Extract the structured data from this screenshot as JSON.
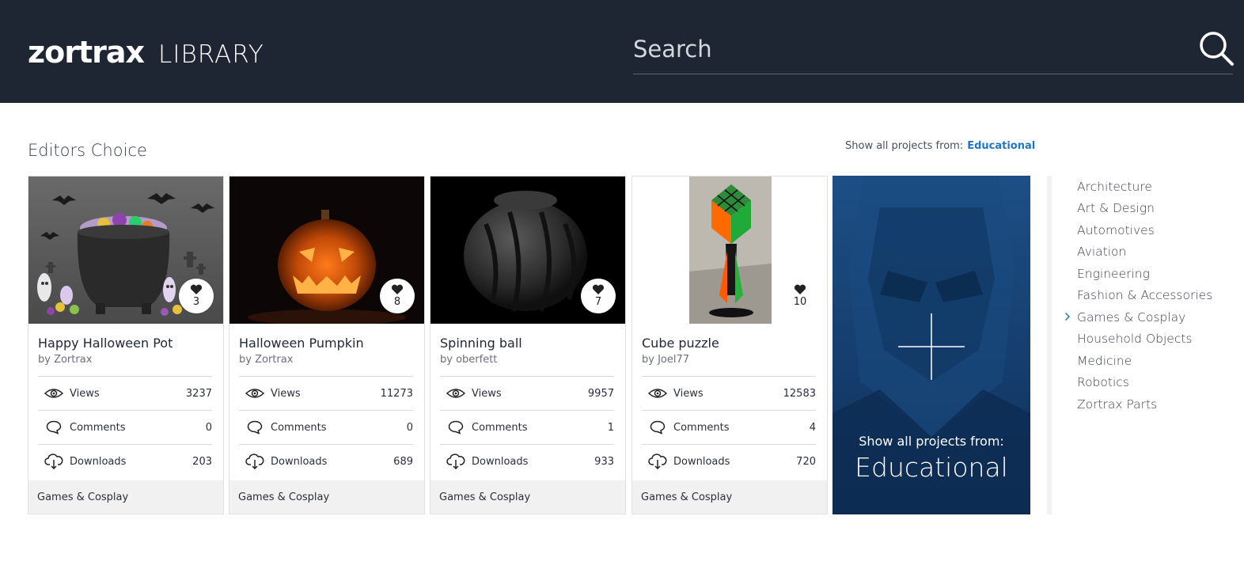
{
  "header": {
    "logo_brand": "zortrax",
    "logo_sub": "LIBRARY",
    "search_placeholder": "Search"
  },
  "section": {
    "title": "Editors Choice",
    "show_all_prefix": "Show all projects from:",
    "show_all_link": "Educational"
  },
  "stat_labels": {
    "views": "Views",
    "comments": "Comments",
    "downloads": "Downloads"
  },
  "cards": [
    {
      "title": "Happy Halloween Pot",
      "author": "by Zortrax",
      "likes": "3",
      "views": "3237",
      "comments": "0",
      "downloads": "203",
      "category": "Games & Cosplay"
    },
    {
      "title": "Halloween Pumpkin",
      "author": "by Zortrax",
      "likes": "8",
      "views": "11273",
      "comments": "0",
      "downloads": "689",
      "category": "Games & Cosplay"
    },
    {
      "title": "Spinning ball",
      "author": "by oberfett",
      "likes": "7",
      "views": "9957",
      "comments": "1",
      "downloads": "933",
      "category": "Games & Cosplay"
    },
    {
      "title": "Cube puzzle",
      "author": "by Joel77",
      "likes": "10",
      "views": "12583",
      "comments": "4",
      "downloads": "720",
      "category": "Games & Cosplay"
    }
  ],
  "promo": {
    "line1": "Show all projects from:",
    "line2": "Educational"
  },
  "categories": [
    {
      "label": "Architecture"
    },
    {
      "label": "Art & Design"
    },
    {
      "label": "Automotives"
    },
    {
      "label": "Aviation"
    },
    {
      "label": "Engineering"
    },
    {
      "label": "Fashion & Accessories"
    },
    {
      "label": "Games & Cosplay",
      "active": true
    },
    {
      "label": "Household Objects"
    },
    {
      "label": "Medicine"
    },
    {
      "label": "Robotics"
    },
    {
      "label": "Zortrax Parts"
    }
  ],
  "colors": {
    "header_bg": "#1f2633",
    "link_blue": "#1f77c9",
    "promo_blue": "#163f70",
    "category_bar": "#f1f1f1"
  },
  "icons": [
    "search-icon",
    "heart-icon",
    "eye-icon",
    "comment-icon",
    "download-cloud-icon",
    "plus-icon",
    "chevron-right-icon"
  ]
}
